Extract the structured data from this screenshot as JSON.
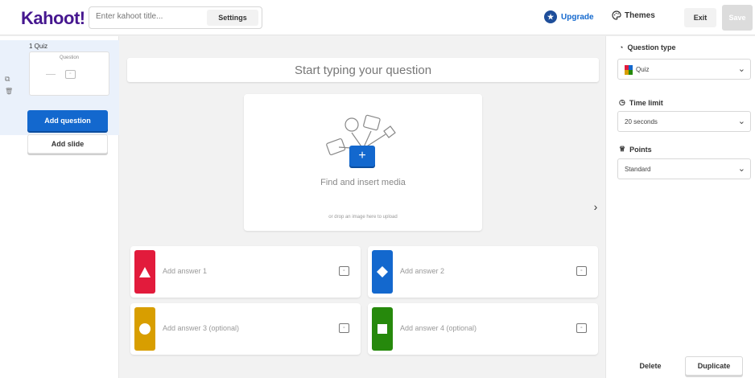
{
  "header": {
    "logo": "Kahoot!",
    "title_placeholder": "Enter kahoot title...",
    "settings_label": "Settings",
    "upgrade_label": "Upgrade",
    "themes_label": "Themes",
    "exit_label": "Exit",
    "save_label": "Save"
  },
  "sidebar": {
    "slide": {
      "label": "1 Quiz",
      "thumb_text": "Question"
    },
    "add_question_label": "Add question",
    "add_slide_label": "Add slide"
  },
  "editor": {
    "question_placeholder": "Start typing your question",
    "media_title": "Find and insert media",
    "media_sub": "or drop an image here to upload",
    "answers": [
      {
        "label": "Add answer 1",
        "color": "#e21b3c",
        "shape": "triangle"
      },
      {
        "label": "Add answer 2",
        "color": "#1368ce",
        "shape": "diamond"
      },
      {
        "label": "Add answer 3 (optional)",
        "color": "#d89e00",
        "shape": "circle"
      },
      {
        "label": "Add answer 4 (optional)",
        "color": "#26890c",
        "shape": "square"
      }
    ]
  },
  "panel": {
    "question_type_label": "Question type",
    "question_type_value": "Quiz",
    "time_limit_label": "Time limit",
    "time_limit_value": "20 seconds",
    "points_label": "Points",
    "points_value": "Standard",
    "delete_label": "Delete",
    "duplicate_label": "Duplicate"
  },
  "colors": {
    "brand": "#46178f",
    "primary_button": "#1368ce"
  }
}
